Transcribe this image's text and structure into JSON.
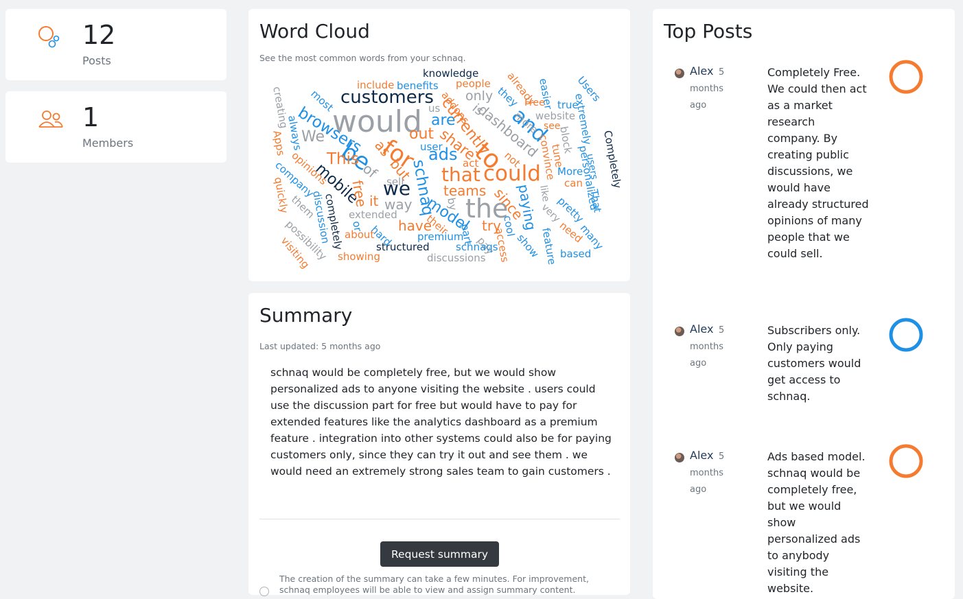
{
  "stats": {
    "posts": {
      "value": "12",
      "label": "Posts",
      "icon": "bubbles-icon"
    },
    "members": {
      "value": "1",
      "label": "Members",
      "icon": "users-icon"
    }
  },
  "colors": {
    "orange": "#f47b30",
    "blue": "#1e90e6",
    "navy": "#0d2a4a",
    "gray": "#9aa0a6"
  },
  "word_cloud": {
    "title": "Word Cloud",
    "subtitle": "See the most common words from your schnaq.",
    "words": [
      {
        "t": "would",
        "c": "gray"
      },
      {
        "t": "customers",
        "c": "navy"
      },
      {
        "t": "be",
        "c": "blue"
      },
      {
        "t": "for",
        "c": "orange"
      },
      {
        "t": "the",
        "c": "gray"
      },
      {
        "t": "that",
        "c": "orange"
      },
      {
        "t": "could",
        "c": "orange"
      },
      {
        "t": "we",
        "c": "navy"
      },
      {
        "t": "to",
        "c": "orange"
      },
      {
        "t": "and",
        "c": "blue"
      },
      {
        "t": "ads",
        "c": "blue"
      },
      {
        "t": "are",
        "c": "blue"
      },
      {
        "t": "out",
        "c": "orange"
      },
      {
        "t": "This",
        "c": "orange"
      },
      {
        "t": "browsers",
        "c": "blue"
      },
      {
        "t": "mobile",
        "c": "navy"
      },
      {
        "t": "schnaq",
        "c": "blue"
      },
      {
        "t": "model",
        "c": "blue"
      },
      {
        "t": "currently",
        "c": "orange"
      },
      {
        "t": "share",
        "c": "orange"
      },
      {
        "t": "dashboard",
        "c": "gray"
      },
      {
        "t": "teams",
        "c": "orange"
      },
      {
        "t": "since",
        "c": "orange"
      },
      {
        "t": "paying",
        "c": "blue"
      },
      {
        "t": "have",
        "c": "orange"
      },
      {
        "t": "try",
        "c": "orange"
      },
      {
        "t": "way",
        "c": "gray"
      },
      {
        "t": "knowledge",
        "c": "navy"
      },
      {
        "t": "include",
        "c": "orange"
      },
      {
        "t": "benefits",
        "c": "blue"
      },
      {
        "t": "people",
        "c": "orange"
      },
      {
        "t": "only",
        "c": "gray"
      },
      {
        "t": "already",
        "c": "orange"
      },
      {
        "t": "they",
        "c": "blue"
      },
      {
        "t": "Users",
        "c": "blue"
      },
      {
        "t": "easier",
        "c": "blue"
      },
      {
        "t": "true",
        "c": "blue"
      },
      {
        "t": "Free",
        "c": "orange"
      },
      {
        "t": "website",
        "c": "gray"
      },
      {
        "t": "more",
        "c": "gray"
      },
      {
        "t": "see",
        "c": "orange"
      },
      {
        "t": "block",
        "c": "gray"
      },
      {
        "t": "extremely",
        "c": "blue"
      },
      {
        "t": "Completely",
        "c": "navy"
      },
      {
        "t": "personalized",
        "c": "blue"
      },
      {
        "t": "users",
        "c": "blue"
      },
      {
        "t": "That",
        "c": "blue"
      },
      {
        "t": "convince",
        "c": "orange"
      },
      {
        "t": "tune",
        "c": "orange"
      },
      {
        "t": "More",
        "c": "blue"
      },
      {
        "t": "can",
        "c": "orange"
      },
      {
        "t": "like",
        "c": "gray"
      },
      {
        "t": "pretty",
        "c": "blue"
      },
      {
        "t": "very",
        "c": "gray"
      },
      {
        "t": "need",
        "c": "orange"
      },
      {
        "t": "many",
        "c": "blue"
      },
      {
        "t": "feature",
        "c": "blue"
      },
      {
        "t": "based",
        "c": "blue"
      },
      {
        "t": "show",
        "c": "blue"
      },
      {
        "t": "access",
        "c": "orange"
      },
      {
        "t": "cool",
        "c": "blue"
      },
      {
        "t": "pay",
        "c": "gray"
      },
      {
        "t": "part",
        "c": "blue"
      },
      {
        "t": "schnaqs",
        "c": "blue"
      },
      {
        "t": "premium",
        "c": "blue"
      },
      {
        "t": "discussions",
        "c": "gray"
      },
      {
        "t": "structured",
        "c": "navy"
      },
      {
        "t": "showing",
        "c": "orange"
      },
      {
        "t": "about",
        "c": "orange"
      },
      {
        "t": "hard",
        "c": "blue"
      },
      {
        "t": "or",
        "c": "blue"
      },
      {
        "t": "extended",
        "c": "gray"
      },
      {
        "t": "completely",
        "c": "navy"
      },
      {
        "t": "discussion",
        "c": "blue"
      },
      {
        "t": "them",
        "c": "gray"
      },
      {
        "t": "possibility",
        "c": "gray"
      },
      {
        "t": "visiting",
        "c": "orange"
      },
      {
        "t": "quickly",
        "c": "orange"
      },
      {
        "t": "company",
        "c": "blue"
      },
      {
        "t": "opinions",
        "c": "orange"
      },
      {
        "t": "Apps",
        "c": "orange"
      },
      {
        "t": "always",
        "c": "blue"
      },
      {
        "t": "creating",
        "c": "gray"
      },
      {
        "t": "most",
        "c": "blue"
      },
      {
        "t": "We",
        "c": "gray"
      },
      {
        "t": "of",
        "c": "gray"
      },
      {
        "t": "as",
        "c": "orange"
      },
      {
        "t": "but",
        "c": "orange"
      },
      {
        "t": "free",
        "c": "orange"
      },
      {
        "t": "it",
        "c": "orange"
      },
      {
        "t": "sell",
        "c": "gray"
      },
      {
        "t": "user",
        "c": "blue"
      },
      {
        "t": "us",
        "c": "gray"
      },
      {
        "t": "addons",
        "c": "orange"
      },
      {
        "t": "is",
        "c": "gray"
      },
      {
        "t": "act",
        "c": "orange"
      },
      {
        "t": "not",
        "c": "orange"
      },
      {
        "t": "their",
        "c": "orange"
      },
      {
        "t": "by",
        "c": "gray"
      }
    ]
  },
  "summary": {
    "title": "Summary",
    "last_updated": "Last updated: 5 months ago",
    "text": "schnaq would be completely free, but we would show personalized ads to anyone visiting the website . users could use the discussion part for free but would have to pay for extended features like the analytics dashboard as a premium feature . integration into other systems could also be for paying customers only, since they can try it out and see them . we would need an extremely strong sales team to gain customers .",
    "button_label": "Request summary",
    "note": "The creation of the summary can take a few minutes. For improvement, schnaq employees will be able to view and assign summary content."
  },
  "top_posts": {
    "title": "Top Posts",
    "posts": [
      {
        "author": "Alex",
        "time": "5 months ago",
        "text": "Completely Free. We could then act as a market research company. By creating public discussions, we would have already structured opinions of many people that we could sell.",
        "ring_color": "#f47b30"
      },
      {
        "author": "Alex",
        "time": "5 months ago",
        "text": "Subscribers only. Only paying customers would get access to schnaq.",
        "ring_color": "#1e90e6"
      },
      {
        "author": "Alex",
        "time": "5 months ago",
        "text": "Ads based model. schnaq would be completely free, but we would show personalized ads to anybody visiting the website.",
        "ring_color": "#f47b30"
      }
    ]
  }
}
